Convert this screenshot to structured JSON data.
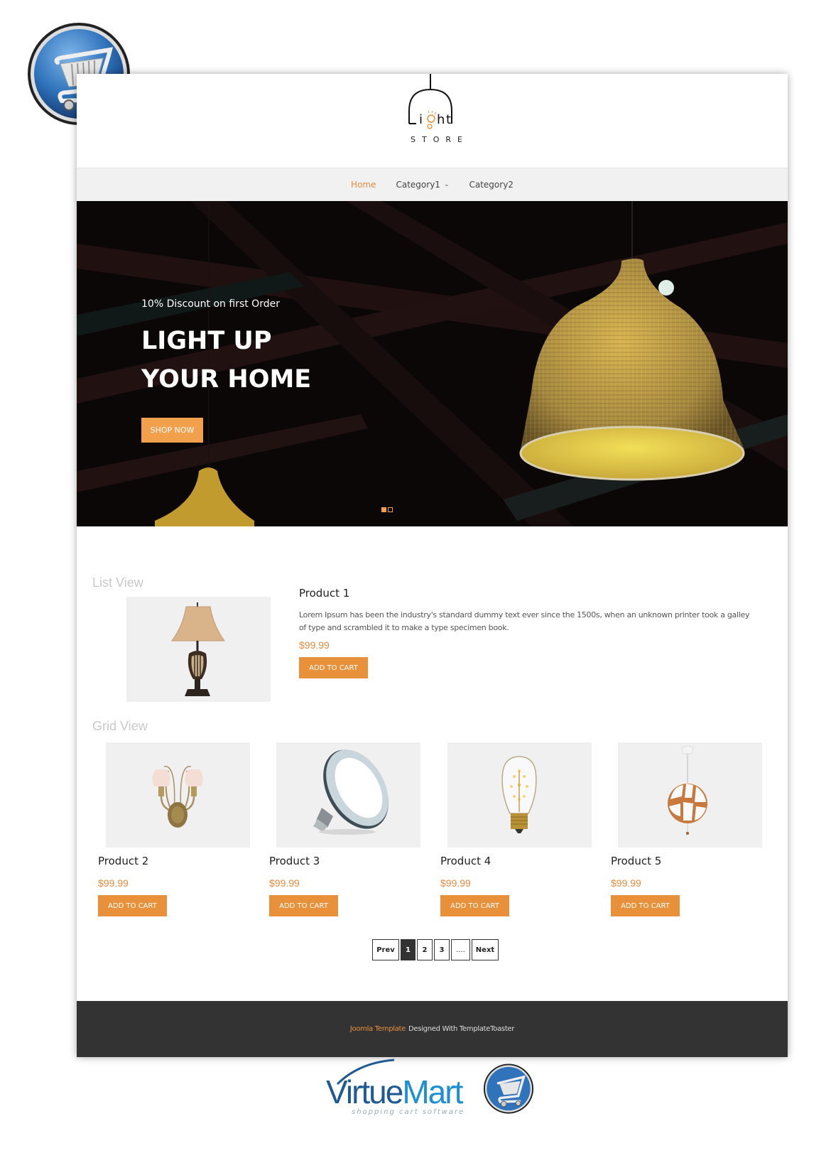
{
  "badges": {
    "top_left_icon": "shopping-cart-icon",
    "bottom_brand": {
      "name_part1": "Virtue",
      "name_part2": "Mart",
      "tagline": "shopping cart software",
      "icon": "shopping-cart-icon"
    }
  },
  "header": {
    "logo_word": "Light",
    "logo_sub": "STORE"
  },
  "nav": {
    "items": [
      {
        "label": "Home",
        "active": true
      },
      {
        "label": "Category1",
        "has_dropdown": true
      },
      {
        "label": "Category2"
      }
    ]
  },
  "hero": {
    "subtitle": "10% Discount on first Order",
    "title_line1": "LIGHT UP",
    "title_line2": "YOUR HOME",
    "button": "SHOP NOW",
    "slides": 2,
    "active_slide": 1
  },
  "list_view": {
    "title": "List View",
    "product": {
      "name": "Product 1",
      "description": "Lorem Ipsum has been the industry's standard dummy text ever since the 1500s, when an unknown printer took a galley of type and scrambled it to make a type specimen book.",
      "price": "$99.99",
      "button": "ADD TO CART",
      "image": "table-lamp"
    }
  },
  "grid_view": {
    "title": "Grid View",
    "products": [
      {
        "name": "Product 2",
        "price": "$99.99",
        "button": "ADD TO CART",
        "image": "wall-sconce"
      },
      {
        "name": "Product 3",
        "price": "$99.99",
        "button": "ADD TO CART",
        "image": "led-panel"
      },
      {
        "name": "Product 4",
        "price": "$99.99",
        "button": "ADD TO CART",
        "image": "edison-bulb"
      },
      {
        "name": "Product 5",
        "price": "$99.99",
        "button": "ADD TO CART",
        "image": "pendant-globe"
      }
    ]
  },
  "pagination": {
    "prev": "Prev",
    "pages": [
      "1",
      "2",
      "3"
    ],
    "ellipsis": "....",
    "next": "Next",
    "current": "1"
  },
  "footer": {
    "link": "Joomla Template",
    "text": "Designed With TemplateToaster"
  },
  "colors": {
    "accent": "#e8913a",
    "footer_bg": "#333333",
    "nav_bg": "#f1f1f1"
  }
}
